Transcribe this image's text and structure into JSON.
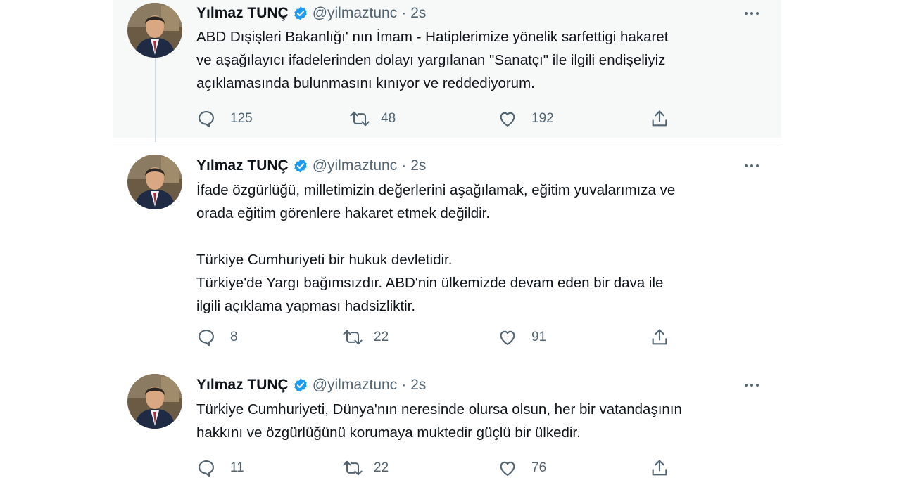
{
  "tweets": [
    {
      "author": "Yılmaz TUNÇ",
      "handle": "@yilmaztunc",
      "separator": "·",
      "time": "2s",
      "text": "ABD Dışişleri Bakanlığı' nın İmam - Hatiplerimize yönelik sarfettigi hakaret\nve aşağılayıcı ifadelerinden dolayı yargılanan \"Sanatçı\" ile ilgili endişeliyiz\naçıklamasında bulunmasını kınıyor ve reddediyorum.",
      "replies": "125",
      "retweets": "48",
      "likes": "192"
    },
    {
      "author": "Yılmaz TUNÇ",
      "handle": "@yilmaztunc",
      "separator": "·",
      "time": "2s",
      "text": "İfade özgürlüğü, milletimizin değerlerini aşağılamak, eğitim yuvalarımıza ve\norada eğitim görenlere hakaret etmek değildir.\n\nTürkiye Cumhuriyeti bir hukuk devletidir.\nTürkiye'de Yargı bağımsızdır.  ABD'nin ülkemizde devam eden bir dava ile\nilgili açıklama yapması hadsizliktir.",
      "replies": "8",
      "retweets": "22",
      "likes": "91"
    },
    {
      "author": "Yılmaz TUNÇ",
      "handle": "@yilmaztunc",
      "separator": "·",
      "time": "2s",
      "text": "Türkiye Cumhuriyeti, Dünya'nın neresinde olursa olsun, her bir vatandaşının\nhakkını ve özgürlüğünü korumaya muktedir güçlü bir ülkedir.",
      "replies": "11",
      "retweets": "22",
      "likes": "76"
    }
  ],
  "colors": {
    "verified": "#1d9bf0",
    "muted": "#536471",
    "text": "#0f1419",
    "thread_line": "#cfd9de",
    "highlight_bg": "#f7f9f9"
  },
  "icons": [
    "verified-badge-icon",
    "more-icon",
    "reply-icon",
    "retweet-icon",
    "like-icon",
    "share-icon"
  ]
}
